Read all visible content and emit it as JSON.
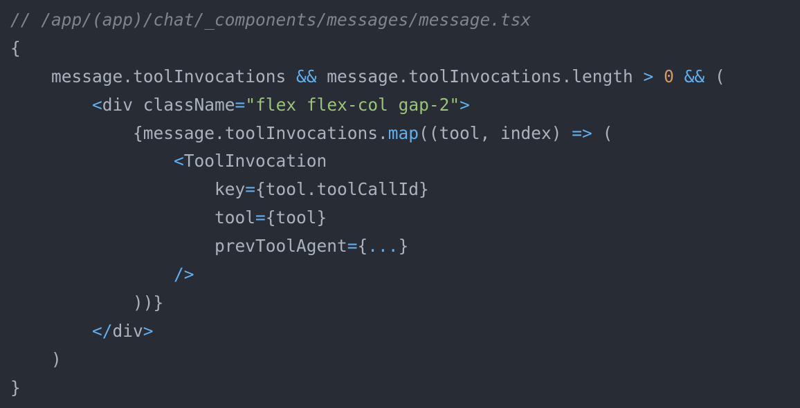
{
  "file": {
    "comment": "// /app/(app)/chat/_components/messages/message.tsx"
  },
  "theme": {
    "background": "#282c34",
    "text": "#abb2bf",
    "comment": "#7f848e",
    "operator": "#61afef",
    "number": "#d19a66",
    "string": "#98c379"
  },
  "code": {
    "lines": [
      [
        {
          "t": "comment",
          "v": "// /app/(app)/chat/_components/messages/message.tsx"
        }
      ],
      [
        {
          "t": "plain",
          "v": "{"
        }
      ],
      [
        {
          "t": "plain",
          "v": "    message.toolInvocations "
        },
        {
          "t": "op",
          "v": "&&"
        },
        {
          "t": "plain",
          "v": " message.toolInvocations.length "
        },
        {
          "t": "op",
          "v": ">"
        },
        {
          "t": "plain",
          "v": " "
        },
        {
          "t": "num",
          "v": "0"
        },
        {
          "t": "plain",
          "v": " "
        },
        {
          "t": "op",
          "v": "&&"
        },
        {
          "t": "plain",
          "v": " ("
        }
      ],
      [
        {
          "t": "plain",
          "v": "        "
        },
        {
          "t": "op",
          "v": "<"
        },
        {
          "t": "plain",
          "v": "div className"
        },
        {
          "t": "op",
          "v": "="
        },
        {
          "t": "str",
          "v": "\"flex flex-col gap-2\""
        },
        {
          "t": "op",
          "v": ">"
        }
      ],
      [
        {
          "t": "plain",
          "v": "            {message.toolInvocations."
        },
        {
          "t": "fn",
          "v": "map"
        },
        {
          "t": "plain",
          "v": "((tool, index) "
        },
        {
          "t": "op",
          "v": "=>"
        },
        {
          "t": "plain",
          "v": " ("
        }
      ],
      [
        {
          "t": "plain",
          "v": "                "
        },
        {
          "t": "op",
          "v": "<"
        },
        {
          "t": "plain",
          "v": "ToolInvocation"
        }
      ],
      [
        {
          "t": "plain",
          "v": "                    key"
        },
        {
          "t": "op",
          "v": "="
        },
        {
          "t": "plain",
          "v": "{tool.toolCallId}"
        }
      ],
      [
        {
          "t": "plain",
          "v": "                    tool"
        },
        {
          "t": "op",
          "v": "="
        },
        {
          "t": "plain",
          "v": "{tool}"
        }
      ],
      [
        {
          "t": "plain",
          "v": "                    prevToolAgent"
        },
        {
          "t": "op",
          "v": "="
        },
        {
          "t": "plain",
          "v": "{"
        },
        {
          "t": "op",
          "v": "..."
        },
        {
          "t": "plain",
          "v": "}"
        }
      ],
      [
        {
          "t": "plain",
          "v": "                "
        },
        {
          "t": "op",
          "v": "/>"
        }
      ],
      [
        {
          "t": "plain",
          "v": "            ))}"
        }
      ],
      [
        {
          "t": "plain",
          "v": "        "
        },
        {
          "t": "op",
          "v": "</"
        },
        {
          "t": "plain",
          "v": "div"
        },
        {
          "t": "op",
          "v": ">"
        }
      ],
      [
        {
          "t": "plain",
          "v": "    )"
        }
      ],
      [
        {
          "t": "plain",
          "v": "}"
        }
      ]
    ]
  }
}
